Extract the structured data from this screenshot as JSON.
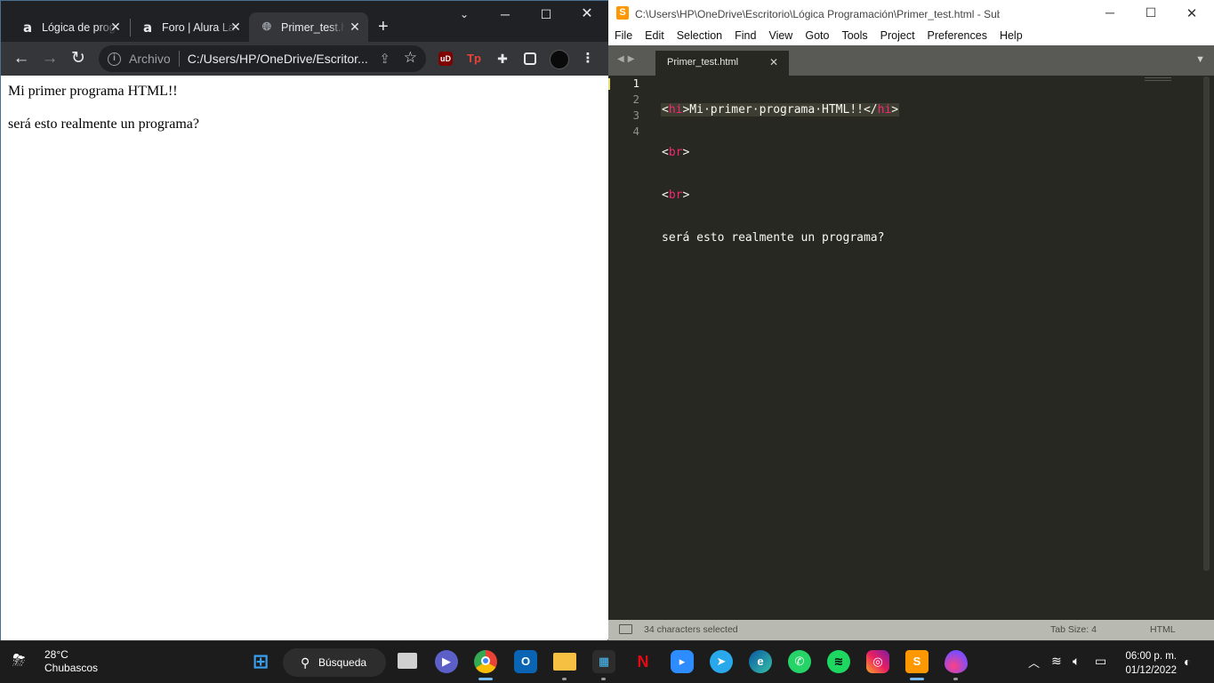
{
  "chrome": {
    "tabs": [
      {
        "title": "Lógica de programación",
        "favicon": "alura-logo-icon"
      },
      {
        "title": "Foro | Alura Latam",
        "favicon": "alura-logo-icon"
      },
      {
        "title": "Primer_test.html",
        "favicon": "globe-icon"
      }
    ],
    "new_tab": "+",
    "address": {
      "scheme_label": "Archivo",
      "url": "C:/Users/HP/OneDrive/Escritor..."
    },
    "page": {
      "line1": "Mi primer programa HTML!!",
      "line2": "será esto realmente un programa?"
    }
  },
  "sublime": {
    "title": "C:\\Users\\HP\\OneDrive\\Escritorio\\Lógica Programación\\Primer_test.html - Sublime Text (UNREG...",
    "menu": [
      "File",
      "Edit",
      "Selection",
      "Find",
      "View",
      "Goto",
      "Tools",
      "Project",
      "Preferences",
      "Help"
    ],
    "tab": "Primer_test.html",
    "line_numbers": [
      "1",
      "2",
      "3",
      "4"
    ],
    "code": {
      "l1_open": "<",
      "l1_tag": "hi",
      "l1_text": ">Mi·primer·programa·HTML!!</",
      "l1_tag2": "hi",
      "l1_close": ">",
      "l2_open": "<",
      "l2_tag": "br",
      "l2_close": ">",
      "l3_open": "<",
      "l3_tag": "br",
      "l3_close": ">",
      "l4": "será esto realmente un programa?"
    },
    "status": {
      "selection": "34 characters selected",
      "tab_size": "Tab Size: 4",
      "syntax": "HTML"
    }
  },
  "taskbar": {
    "weather": {
      "temp": "28°C",
      "desc": "Chubascos"
    },
    "search_label": "Búsqueda",
    "clock": {
      "time": "06:00 p. m.",
      "date": "01/12/2022"
    }
  },
  "colors": {
    "sublime_bg": "#272822",
    "tag": "#f92672",
    "chrome_dark": "#202124"
  }
}
